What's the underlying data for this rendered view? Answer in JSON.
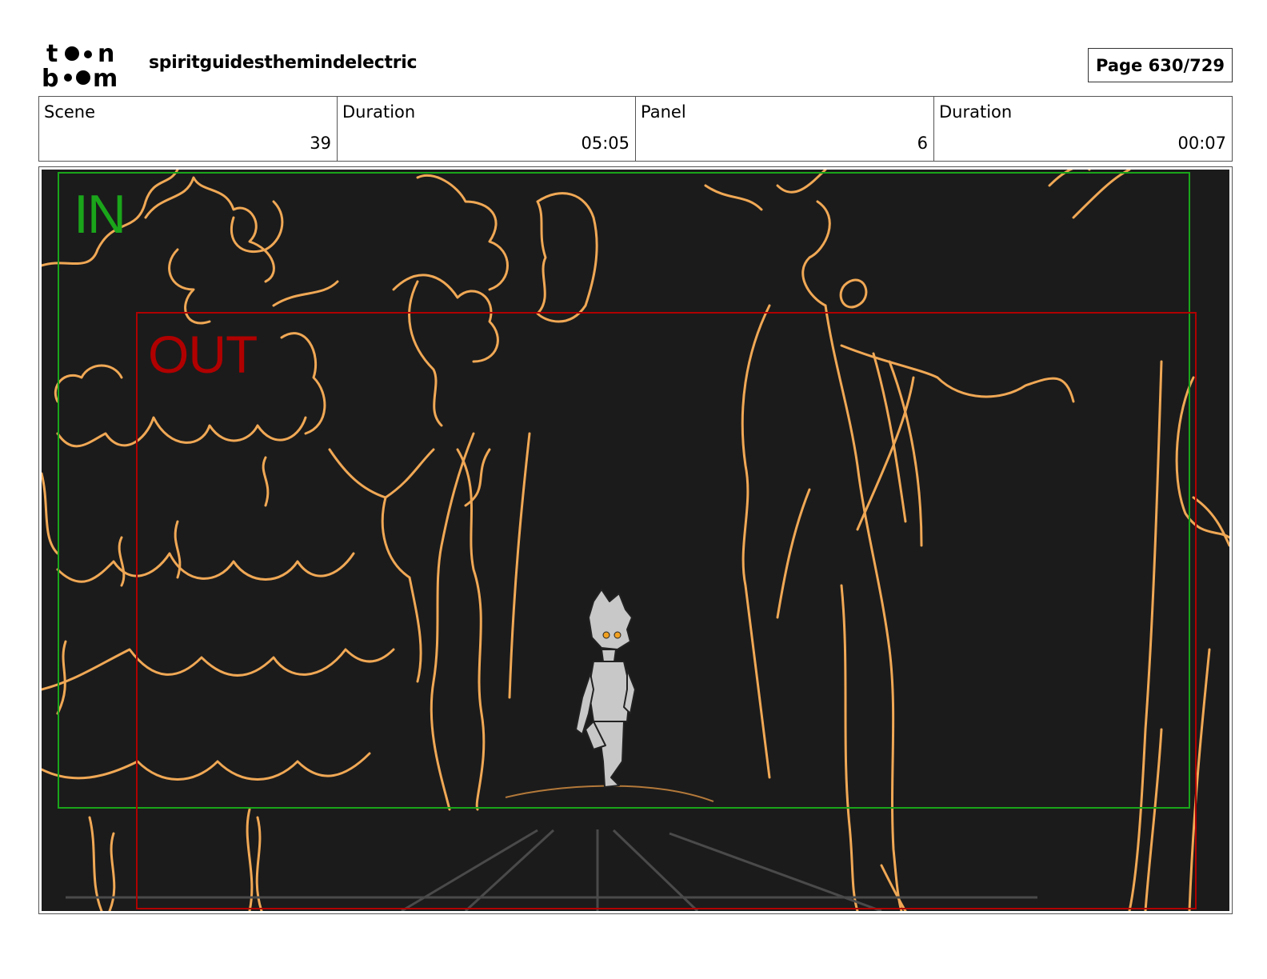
{
  "header": {
    "logo_text": "toon boom",
    "project_title": "spiritguidesthemindelectric",
    "page_label": "Page 630/729"
  },
  "info": [
    {
      "label": "Scene",
      "value": "39"
    },
    {
      "label": "Duration",
      "value": "05:05"
    },
    {
      "label": "Panel",
      "value": "6"
    },
    {
      "label": "Duration",
      "value": "00:07"
    }
  ],
  "panel": {
    "in_label": "IN",
    "out_label": "OUT",
    "colors": {
      "background": "#1b1b1b",
      "sketch": "#f0a855",
      "in_frame": "#1aa51a",
      "out_frame": "#b00000",
      "character": "#c8c8c8"
    }
  }
}
